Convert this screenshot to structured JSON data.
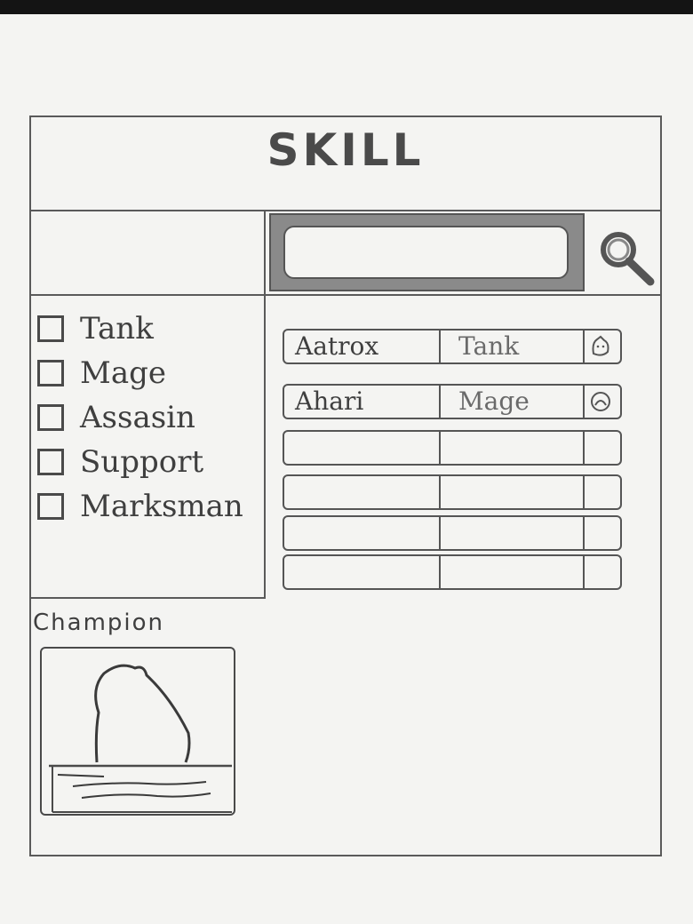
{
  "header": {
    "title": "SKILL"
  },
  "search": {
    "placeholder": "",
    "value": "",
    "icon": "search-icon"
  },
  "filters": [
    {
      "label": "Tank",
      "checked": false
    },
    {
      "label": "Mage",
      "checked": false
    },
    {
      "label": "Assasin",
      "checked": false
    },
    {
      "label": "Support",
      "checked": false
    },
    {
      "label": "Marksman",
      "checked": false
    }
  ],
  "table": {
    "rows": [
      {
        "name": "Aatrox",
        "role": "Tank",
        "icon": "champion-avatar-icon"
      },
      {
        "name": "Ahari",
        "role": "Mage",
        "icon": "champion-avatar-icon"
      },
      {
        "name": "",
        "role": "",
        "icon": ""
      },
      {
        "name": "",
        "role": "",
        "icon": ""
      },
      {
        "name": "",
        "role": "",
        "icon": ""
      },
      {
        "name": "",
        "role": "",
        "icon": ""
      }
    ]
  },
  "champion": {
    "title": "Champion",
    "image_icon": "champion-silhouette-icon"
  }
}
